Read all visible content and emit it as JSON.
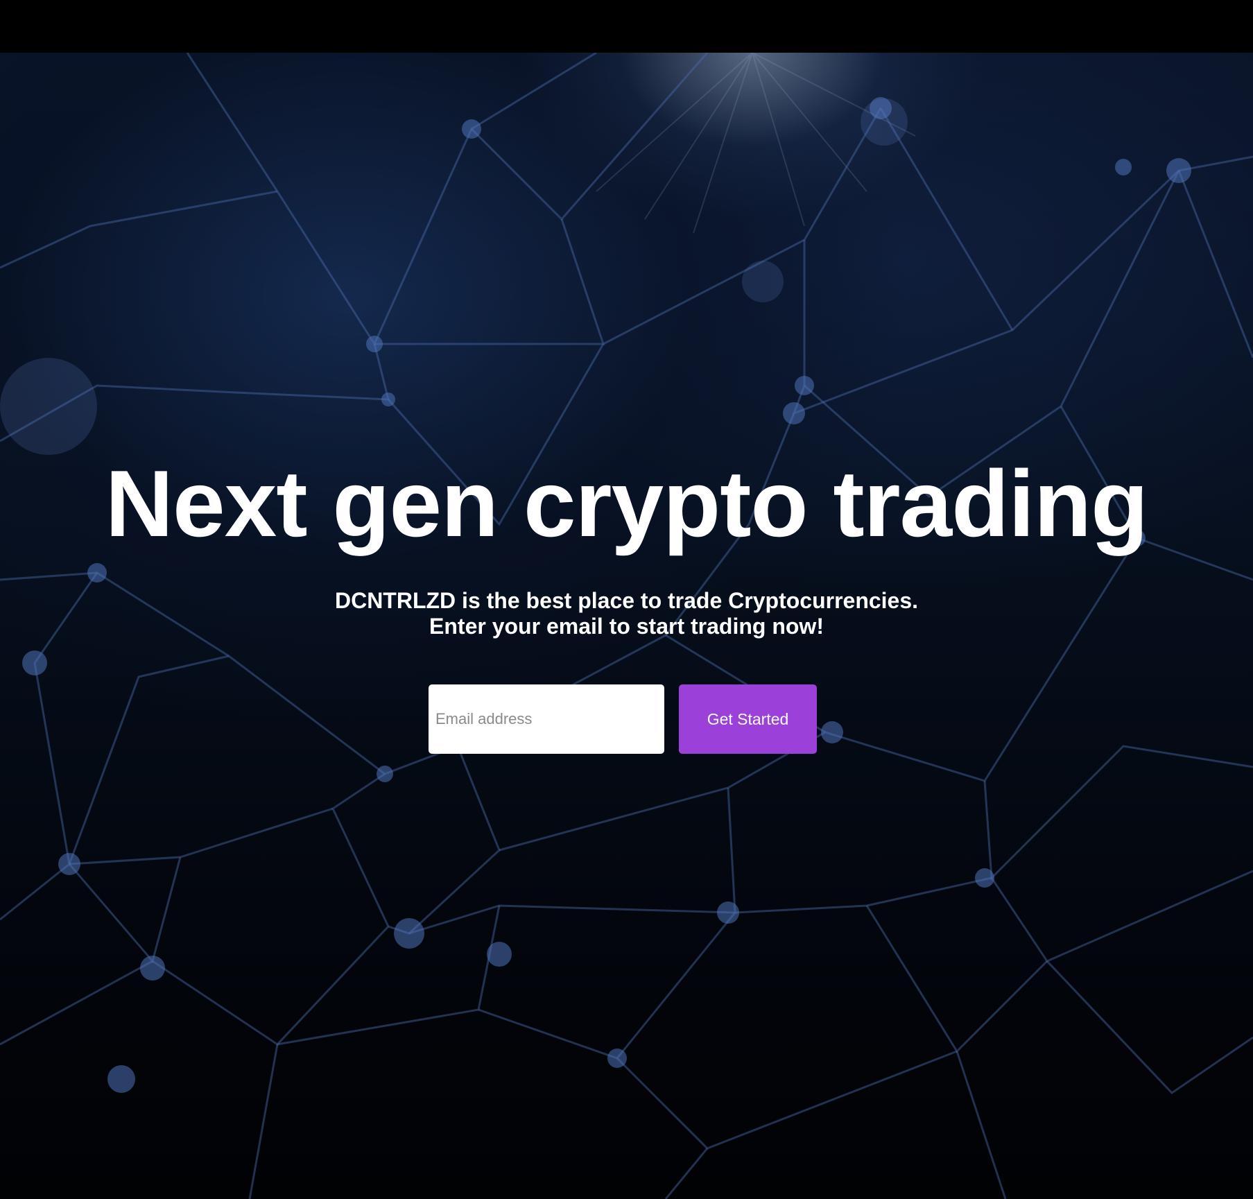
{
  "hero": {
    "headline": "Next gen crypto trading",
    "subtitle_line1": "DCNTRLZD is the best place to trade Cryptocurrencies.",
    "subtitle_line2": "Enter your email to start trading now!"
  },
  "signup_form": {
    "email_placeholder": "Email address",
    "email_value": "",
    "submit_label": "Get Started"
  },
  "colors": {
    "accent": "#9b40d8",
    "text": "#ffffff",
    "background": "#000000",
    "network_lines": "#3a5a9a"
  },
  "background_image": "blockchain-network-graphic"
}
